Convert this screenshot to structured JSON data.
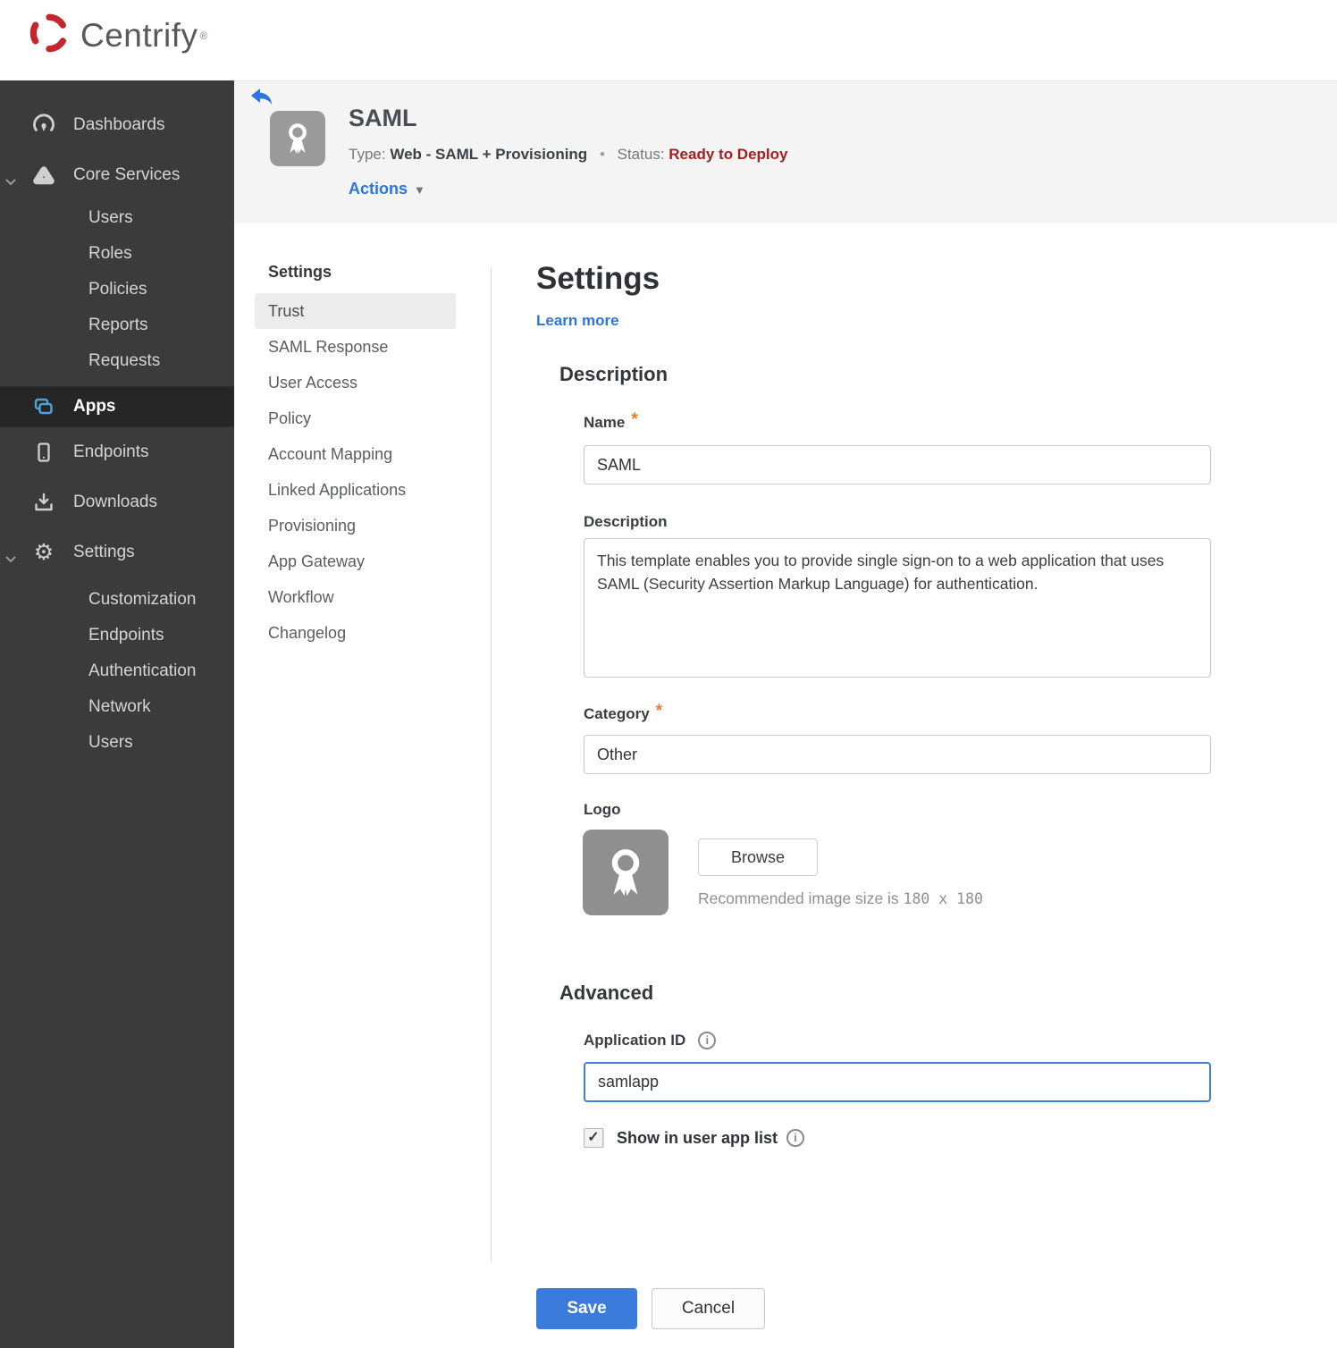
{
  "brand": {
    "name": "Centrify",
    "trademark": "®"
  },
  "colors": {
    "brand_red": "#c1272d",
    "accent_blue": "#3a7bdb",
    "link_blue": "#2a76dd",
    "status_red": "#a32020",
    "asterisk_orange": "#e87a33",
    "sidebar_bg": "#3b3b3b",
    "sidebar_active_bg": "#262626",
    "apps_icon_blue": "#4da3e0",
    "header_band_bg": "#f4f4f5"
  },
  "icons": {
    "gear": "⚙",
    "caret": "▼",
    "check": "✓",
    "info": "i"
  },
  "sidebar": {
    "items": [
      {
        "label": "Dashboards"
      },
      {
        "label": "Core Services"
      },
      {
        "label": "Users"
      },
      {
        "label": "Roles"
      },
      {
        "label": "Policies"
      },
      {
        "label": "Reports"
      },
      {
        "label": "Requests"
      },
      {
        "label": "Apps"
      },
      {
        "label": "Endpoints"
      },
      {
        "label": "Downloads"
      },
      {
        "label": "Settings"
      },
      {
        "label": "Customization"
      },
      {
        "label": "Endpoints"
      },
      {
        "label": "Authentication"
      },
      {
        "label": "Network"
      },
      {
        "label": "Users"
      }
    ]
  },
  "header": {
    "title": "SAML",
    "type_label": "Type:",
    "type_value": "Web - SAML + Provisioning",
    "dot": "•",
    "status_label": "Status:",
    "status_value": "Ready to Deploy",
    "actions_label": "Actions"
  },
  "subnav": {
    "header": "Settings",
    "items": [
      {
        "label": "Trust"
      },
      {
        "label": "SAML Response"
      },
      {
        "label": "User Access"
      },
      {
        "label": "Policy"
      },
      {
        "label": "Account Mapping"
      },
      {
        "label": "Linked Applications"
      },
      {
        "label": "Provisioning"
      },
      {
        "label": "App Gateway"
      },
      {
        "label": "Workflow"
      },
      {
        "label": "Changelog"
      }
    ]
  },
  "main": {
    "title": "Settings",
    "learn_more": "Learn more",
    "required_mark": "*",
    "description": {
      "heading": "Description",
      "name_label": "Name",
      "name_value": "SAML",
      "desc_label": "Description",
      "desc_value": "This template enables you to provide single sign-on to a web application that uses SAML (Security Assertion Markup Language) for authentication.",
      "category_label": "Category",
      "category_value": "Other",
      "logo_label": "Logo",
      "browse_label": "Browse",
      "recommended_prefix": "Recommended image size is ",
      "recommended_size": "180 x 180"
    },
    "advanced": {
      "heading": "Advanced",
      "app_id_label": "Application ID",
      "app_id_value": "samlapp",
      "show_in_list_label": "Show in user app list",
      "show_in_list_checked": true
    },
    "footer": {
      "save_label": "Save",
      "cancel_label": "Cancel"
    }
  }
}
